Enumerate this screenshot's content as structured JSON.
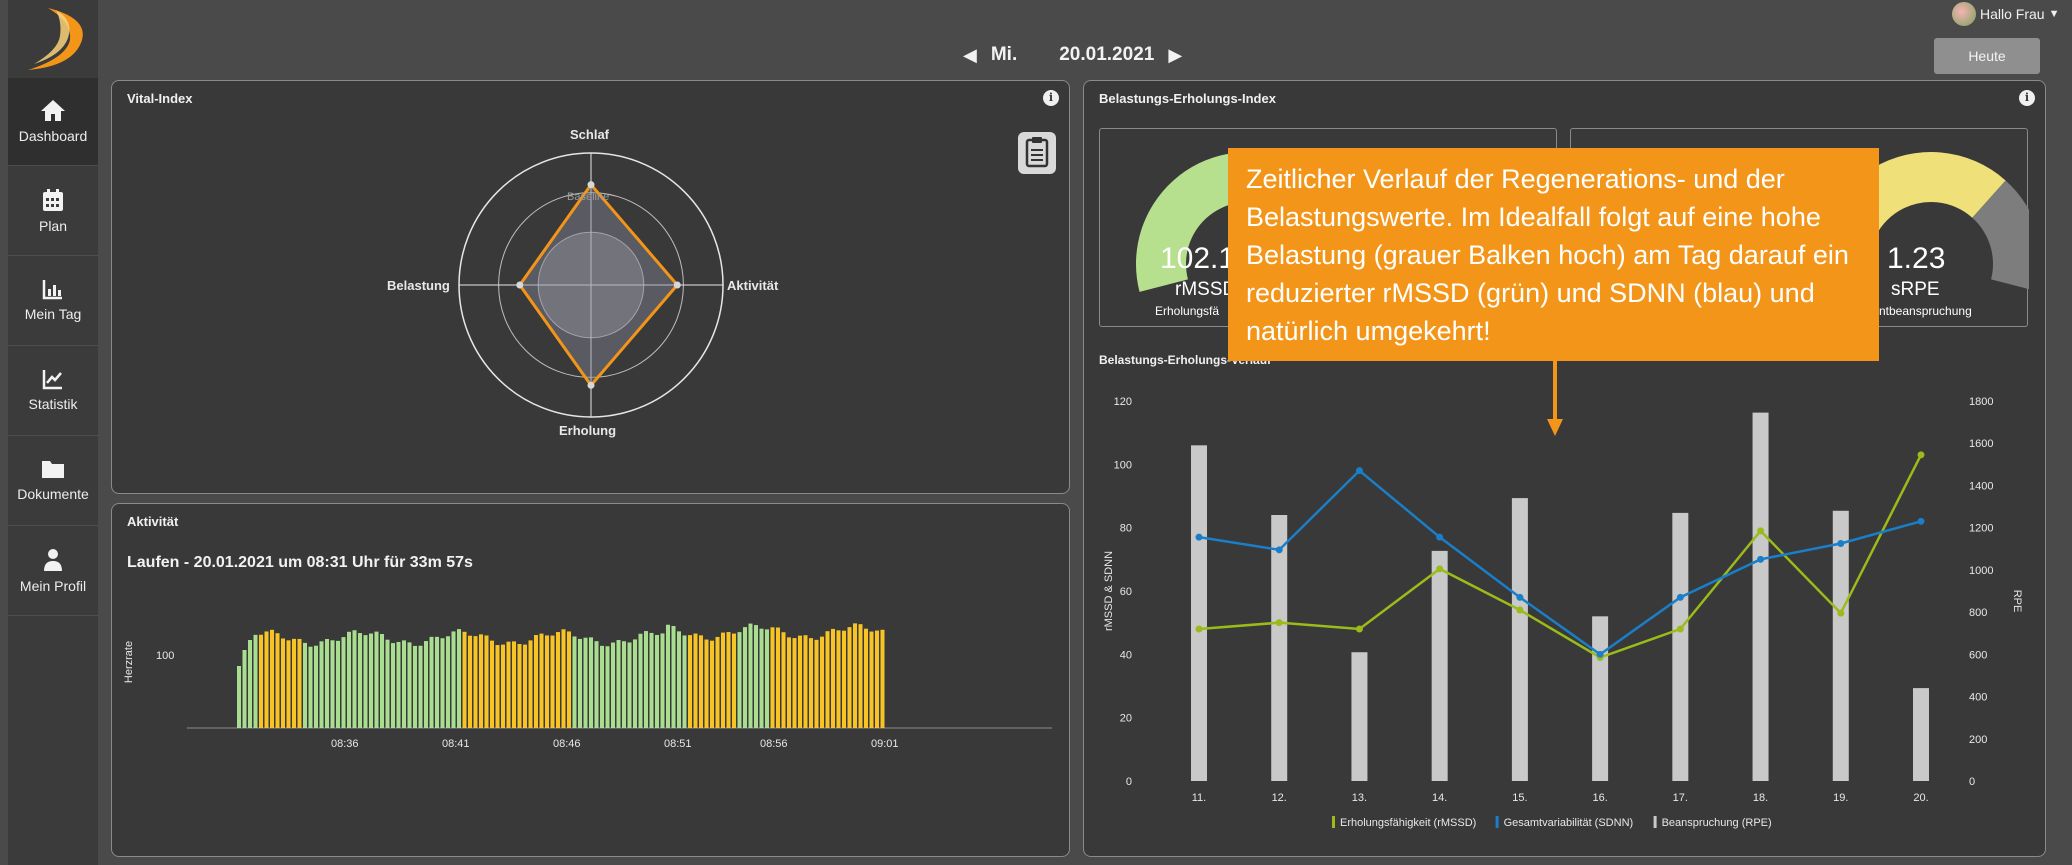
{
  "topbar": {
    "day": "Mi.",
    "date": "20.01.2021",
    "today_button": "Heute",
    "greeting": "Hallo Frau"
  },
  "sidebar": {
    "items": [
      {
        "label": "Dashboard",
        "icon": "home-icon"
      },
      {
        "label": "Plan",
        "icon": "calendar-icon"
      },
      {
        "label": "Mein Tag",
        "icon": "bar-chart-icon"
      },
      {
        "label": "Statistik",
        "icon": "line-chart-icon"
      },
      {
        "label": "Dokumente",
        "icon": "folder-icon"
      },
      {
        "label": "Mein Profil",
        "icon": "user-icon"
      }
    ]
  },
  "vital": {
    "title": "Vital-Index",
    "axes": {
      "top": "Schlaf",
      "right": "Aktivität",
      "bottom": "Erholung",
      "left": "Belastung"
    },
    "baseline": "Baseline",
    "values": {
      "top": 1.0,
      "right": 0.86,
      "bottom": 1.0,
      "left": 0.71
    }
  },
  "activity": {
    "title": "Aktivität",
    "session": "Laufen - 20.01.2021 um 08:31 Uhr für 33m 57s",
    "ylabel": "Herzrate",
    "ytick": "100",
    "xticks": [
      "08:36",
      "08:41",
      "08:46",
      "08:51",
      "08:56",
      "09:01"
    ],
    "colors": {
      "green": "#a9dd8f",
      "yellow": "#f7c325"
    }
  },
  "belastung": {
    "title": "Belastungs-Erholungs-Index",
    "gauge_left": {
      "value": "102.1",
      "label": "rMSSD",
      "sub": "Erholungsfä",
      "level": 0.6,
      "color": "#b7e08e"
    },
    "gauge_right": {
      "value": "1.23",
      "label": "sRPE",
      "sub": "ntbeanspruchung",
      "level": 0.7,
      "color": "#f0e07a"
    },
    "chart_title": "Belastungs-Erholungs-Verlauf"
  },
  "callout": {
    "text": "Zeitlicher Verlauf der Regenerations- und der Belastungswerte. Im Idealfall folgt auf eine hohe Belastung (grauer Balken hoch) am Tag darauf ein reduzierter rMSSD (grün) und SDNN (blau) und natürlich umgekehrt!"
  },
  "chart_data": {
    "type": "bar",
    "categories": [
      "11.",
      "12.",
      "13.",
      "14.",
      "15.",
      "16.",
      "17.",
      "18.",
      "19.",
      "20."
    ],
    "ylabel": "rMSSD & SDNN",
    "y2label": "RPE",
    "ylim": [
      0,
      120
    ],
    "y2lim": [
      0,
      1800
    ],
    "yticks": [
      "0",
      "20",
      "40",
      "60",
      "80",
      "100",
      "120"
    ],
    "y2ticks": [
      "0",
      "200",
      "400",
      "600",
      "800",
      "1000",
      "1200",
      "1400",
      "1600",
      "1800"
    ],
    "series": [
      {
        "name": "Erholungsfähigkeit (rMSSD)",
        "type": "line",
        "axis": "left",
        "color": "#9bbb1b",
        "values": [
          48,
          50,
          48,
          67,
          54,
          39,
          48,
          79,
          53,
          103
        ]
      },
      {
        "name": "Gesamtvariabilität (SDNN)",
        "type": "line",
        "axis": "left",
        "color": "#1a7ec8",
        "values": [
          77,
          73,
          98,
          77,
          58,
          40,
          58,
          70,
          75,
          82
        ]
      },
      {
        "name": "Beanspruchung (RPE)",
        "type": "bar",
        "axis": "right",
        "color": "#c9c9c9",
        "values": [
          1590,
          1260,
          610,
          1090,
          1340,
          780,
          1270,
          1745,
          1280,
          440
        ]
      }
    ]
  }
}
